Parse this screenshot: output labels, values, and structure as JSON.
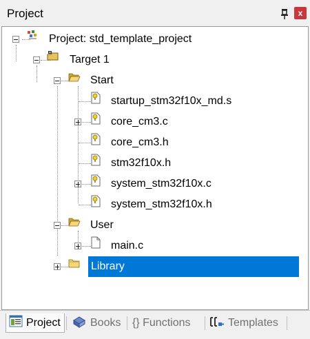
{
  "panel": {
    "title": "Project",
    "pin_icon": "pin-icon",
    "close_icon": "close-icon",
    "close_glyph": "x"
  },
  "tree": {
    "project": {
      "label": "Project: std_template_project",
      "icon": "project-icon",
      "expanded": true
    },
    "target": {
      "label": "Target 1",
      "icon": "target-icon",
      "expanded": true
    },
    "groups": [
      {
        "label": "Start",
        "icon": "folder-open-icon",
        "expanded": true,
        "files": [
          {
            "label": "startup_stm32f10x_md.s",
            "icon": "source-file-icon",
            "expandable": false
          },
          {
            "label": "core_cm3.c",
            "icon": "source-file-icon",
            "expandable": true
          },
          {
            "label": "core_cm3.h",
            "icon": "source-file-icon",
            "expandable": false
          },
          {
            "label": "stm32f10x.h",
            "icon": "source-file-icon",
            "expandable": false
          },
          {
            "label": "system_stm32f10x.c",
            "icon": "source-file-icon",
            "expandable": true
          },
          {
            "label": "system_stm32f10x.h",
            "icon": "source-file-icon",
            "expandable": false
          }
        ]
      },
      {
        "label": "User",
        "icon": "folder-open-icon",
        "expanded": true,
        "files": [
          {
            "label": "main.c",
            "icon": "file-icon",
            "expandable": true
          }
        ]
      },
      {
        "label": "Library",
        "icon": "folder-closed-icon",
        "expanded": false,
        "selected": true,
        "files": []
      }
    ]
  },
  "tabs": [
    {
      "label": "Project",
      "icon": "project-tab-icon",
      "active": true
    },
    {
      "label": "Books",
      "icon": "books-icon",
      "active": false
    },
    {
      "label": "{} Functions",
      "icon": "functions-icon",
      "active": false
    },
    {
      "label": "Templates",
      "icon": "templates-icon",
      "active": false
    }
  ],
  "colors": {
    "selection": "#0078d7",
    "close_button": "#c8373b",
    "panel_background": "#f0f0f0",
    "tree_background": "#ffffff"
  }
}
